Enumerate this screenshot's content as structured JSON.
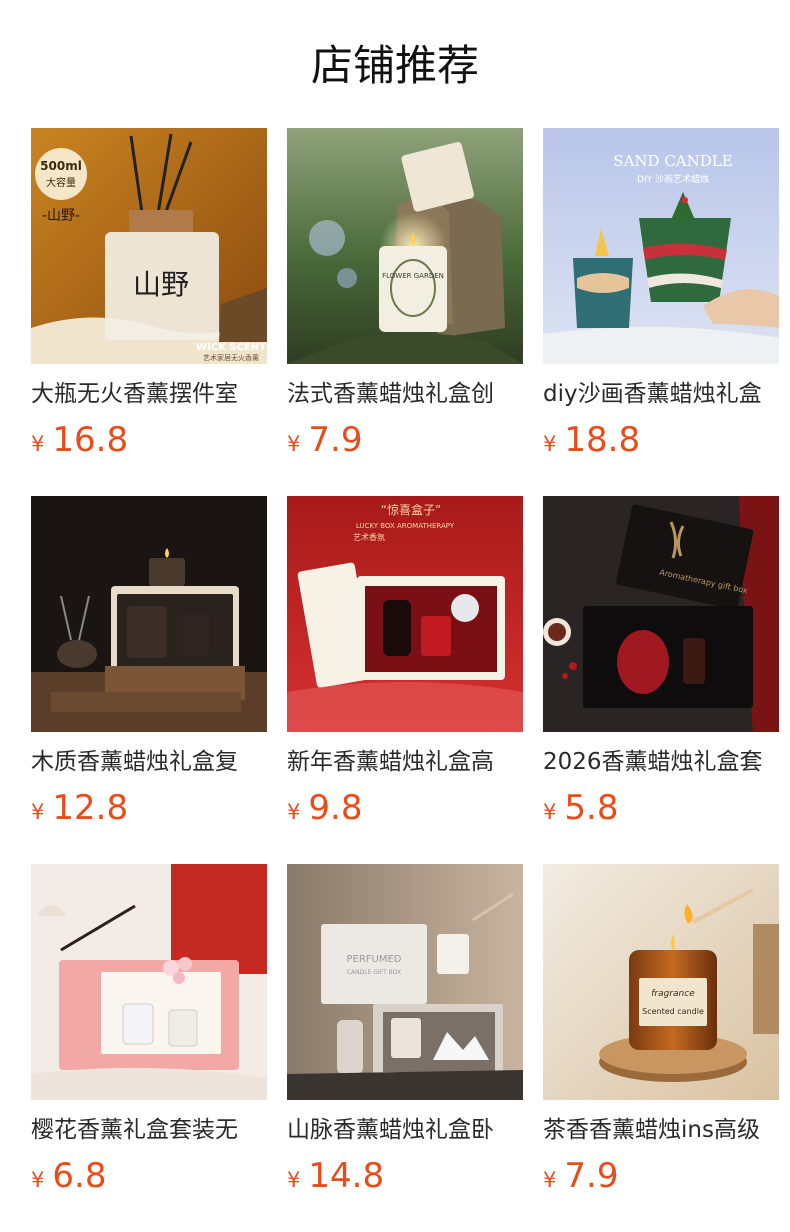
{
  "section": {
    "title": "店铺推荐"
  },
  "colors": {
    "price": "#e84c1a",
    "title": "#111111",
    "text": "#2a2a2a"
  },
  "products": [
    {
      "name": "大瓶无火香薰摆件室",
      "currency": "¥",
      "price": "16.8",
      "image_icon": "reed-diffuser-bottle-image",
      "image_text": [
        "500ml",
        "大容量",
        "-山野-",
        "WICK SCENT",
        "艺术家居无火香薰",
        "山野"
      ]
    },
    {
      "name": "法式香薰蜡烛礼盒创",
      "currency": "¥",
      "price": "7.9",
      "image_icon": "candle-jar-on-rock-image",
      "image_text": [
        "FLOWER GARDEN"
      ]
    },
    {
      "name": "diy沙画香薰蜡烛礼盒",
      "currency": "¥",
      "price": "18.8",
      "image_icon": "sand-art-candle-image",
      "image_text": [
        "SAND CANDLE",
        "DIY 沙画艺术蜡烛"
      ]
    },
    {
      "name": "木质香薰蜡烛礼盒复",
      "currency": "¥",
      "price": "12.8",
      "image_icon": "wooden-gift-box-image",
      "image_text": []
    },
    {
      "name": "新年香薰蜡烛礼盒高",
      "currency": "¥",
      "price": "9.8",
      "image_icon": "red-new-year-gift-box-image",
      "image_text": [
        "“惊喜盒子”",
        "LUCKY BOX AROMATHERAPY",
        "艺术香氛"
      ]
    },
    {
      "name": "2026香薰蜡烛礼盒套",
      "currency": "¥",
      "price": "5.8",
      "image_icon": "black-gift-box-image",
      "image_text": [
        "Aromatherapy gift box"
      ]
    },
    {
      "name": "樱花香薰礼盒套装无",
      "currency": "¥",
      "price": "6.8",
      "image_icon": "pink-gift-box-image",
      "image_text": []
    },
    {
      "name": "山脉香薰蜡烛礼盒卧",
      "currency": "¥",
      "price": "14.8",
      "image_icon": "marble-gift-box-image",
      "image_text": [
        "PERFUMED",
        "CANDLE GIFT BOX"
      ]
    },
    {
      "name": "茶香香薰蜡烛ins高级",
      "currency": "¥",
      "price": "7.9",
      "image_icon": "amber-jar-candle-image",
      "image_text": [
        "fragrance",
        "Scented candle"
      ]
    }
  ]
}
